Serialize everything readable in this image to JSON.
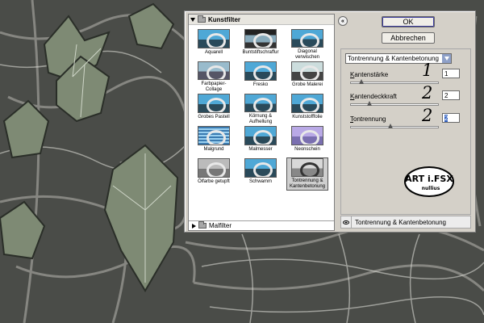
{
  "browser": {
    "category_open": "Kunstfilter",
    "category_closed": "Malfilter",
    "filters": [
      {
        "label": "Aquarell",
        "selected": false
      },
      {
        "label": "Buntstiftschraffur",
        "selected": false
      },
      {
        "label": "Diagonal\nverwischen",
        "selected": false
      },
      {
        "label": "Farbpapier-Collage",
        "selected": false
      },
      {
        "label": "Fresko",
        "selected": false
      },
      {
        "label": "Grobe Malerei",
        "selected": false
      },
      {
        "label": "Grobes Pastell",
        "selected": false
      },
      {
        "label": "Körnung &\nAufhellung",
        "selected": false
      },
      {
        "label": "Kunststofffolie",
        "selected": false
      },
      {
        "label": "Malgrund",
        "selected": false
      },
      {
        "label": "Malmesser",
        "selected": false
      },
      {
        "label": "Neonschein",
        "selected": false
      },
      {
        "label": "Ölfarbe getupft",
        "selected": false
      },
      {
        "label": "Schwamm",
        "selected": false
      },
      {
        "label": "Tontrennung &\nKantenbetonung",
        "selected": true
      }
    ]
  },
  "buttons": {
    "ok": "OK",
    "cancel": "Abbrechen"
  },
  "collapse_glyph": "«",
  "filter_select": {
    "value": "Tontrennung & Kantenbetonung"
  },
  "params": [
    {
      "label_first": "K",
      "label_rest": "antenstärke",
      "value": "1",
      "slider_fraction": 0.1,
      "annotation": "1"
    },
    {
      "label_first": "K",
      "label_rest": "antendeckkraft",
      "value": "2",
      "slider_fraction": 0.2,
      "annotation": "2"
    },
    {
      "label_first": "T",
      "label_rest": "ontrennung",
      "value": "2",
      "slider_fraction": 0.45,
      "annotation": "2"
    }
  ],
  "logo": {
    "text_main": "ART i.FSX",
    "text_sub": "nullius"
  },
  "footer": {
    "effect_layer": "Tontrennung & Kantenbetonung"
  },
  "colors": {
    "accent_blue": "#3060c0",
    "dialog_bg": "#d4d0c8",
    "dropdown_arrow": "#8ea0c8"
  }
}
